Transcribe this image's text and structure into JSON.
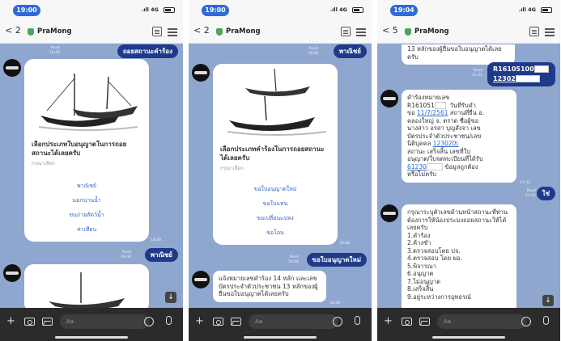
{
  "phones": [
    {
      "time": "19:00",
      "network": "4G",
      "back_count": "2",
      "chat_name": "PraMong",
      "out1": {
        "text": "ถอยสถานะคำร้อง",
        "read": "Read",
        "ts": "18:48"
      },
      "out2": {
        "text": "พาณิชย์",
        "read": "Read",
        "ts": "18:48"
      },
      "card": {
        "title": "เลือกประเภทใบอนุญาตในการถอยสถานะได้เลยครับ",
        "subtitle": "กรุณาเลือก",
        "options": [
          "พาณิชย์",
          "นอกน่านน้ำ",
          "ขนถ่ายสัตว์น้ำ",
          "ท่าเทียบ"
        ],
        "ts": "18:48"
      }
    },
    {
      "time": "19:00",
      "network": "4G",
      "back_count": "2",
      "chat_name": "PraMong",
      "out1": {
        "text": "พาณิชย์",
        "read": "Read",
        "ts": "18:48"
      },
      "card": {
        "title": "เลือกประเภทคำร้องในการถอยสถานะได้เลยครับ",
        "subtitle": "กรุณาเลือก",
        "options": [
          "ขอใบอนุญาตใหม่",
          "ขอใบแทน",
          "ขอเปลี่ยนแปลง",
          "ขอโอน"
        ],
        "ts": "18:48"
      },
      "out2": {
        "text": "ขอใบอนุญาตใหม่",
        "read": "Read",
        "ts": "18:48"
      },
      "incoming": {
        "text": "แจ้งหมายเลขคำร้อง 14 หลัก และเลขบัตรประจำตัวประชาชน 13 หลักของผู้ยื่นขอใบอนุญาตได้เลยครับ",
        "ts": "18:48"
      }
    },
    {
      "time": "19:04",
      "network": "4G",
      "back_count": "5",
      "chat_name": "PraMong",
      "top_text": "13 หลักของผู้ยื่นขอใบอนุญาตได้เลยครับ",
      "out1": {
        "text": "R16105100",
        "text2": "12302",
        "read": "Read",
        "ts": "11:42"
      },
      "info": {
        "l1": "คำร้องหมายเลข",
        "l2a": "R161051",
        "l2b": "วันที่รับคำ",
        "l3a": "ขอ",
        "date": "11/7/2561",
        "l3b": "สถานที่ยื่น อ.",
        "l4": "คลองใหญ่ จ. ตราด ชื่อผู้ขอ",
        "l5": "นางสาว อรสา บุญสังจา เลข",
        "l6": "บัตรประจำตัวประชาชน/เลข",
        "l7a": "นิติบุคคล",
        "idlink": "123020(",
        "l8": "สถานะ เสร็จสิ้น เลขที่ใบ",
        "l9": "อนุญาต/ใบจดทะเบียนที่ได้รับ",
        "numlink": "61230",
        "l10b": "ข้อมูลถูกต้อง",
        "l11": "หรือไม่ครับ",
        "ts": "11:42"
      },
      "out2": {
        "text": "ใช่",
        "read": "Read",
        "ts": "11:42"
      },
      "list": {
        "intro": "กรุณาระบุตัวเลขด้านหน้าสถานะที่ท่านต้องการให้น้องประมงถอยสถานะให้ได้เลยครับ",
        "items": [
          "1.คำร้อง",
          "2.ค้างชำ",
          "3.ตรวจสอบโดย ปจ.",
          "4.ตรวจสอบ โดย ผอ.",
          "5.พิจารณา",
          "6.อนุญาต",
          "7.ไม่อนุญาต",
          "8.เสร็จสิ้น",
          "9.อยู่ระหว่างการอุทธรณ์"
        ]
      }
    }
  ],
  "input_placeholder": "Aa"
}
